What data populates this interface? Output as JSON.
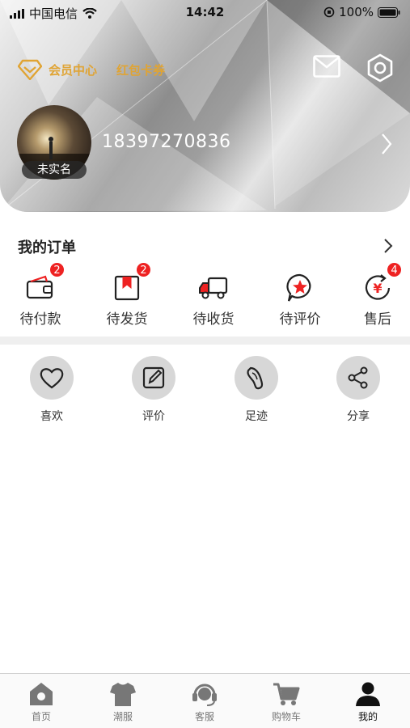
{
  "status_bar": {
    "carrier": "中国电信",
    "time": "14:42",
    "battery": "100%"
  },
  "header": {
    "member_center": "会员中心",
    "red_packet": "红包卡券",
    "avatar_badge": "未实名",
    "phone": "18397270836"
  },
  "orders": {
    "title": "我的订单",
    "items": [
      {
        "label": "待付款",
        "badge": "2"
      },
      {
        "label": "待发货",
        "badge": "2"
      },
      {
        "label": "待收货",
        "badge": ""
      },
      {
        "label": "待评价",
        "badge": ""
      },
      {
        "label": "售后",
        "badge": "4"
      }
    ]
  },
  "tools": [
    {
      "label": "喜欢"
    },
    {
      "label": "评价"
    },
    {
      "label": "足迹"
    },
    {
      "label": "分享"
    }
  ],
  "tabbar": [
    {
      "label": "首页",
      "icon": "home-icon"
    },
    {
      "label": "潮服",
      "icon": "shirt-icon"
    },
    {
      "label": "客服",
      "icon": "headset-icon"
    },
    {
      "label": "购物车",
      "icon": "cart-icon"
    },
    {
      "label": "我的",
      "icon": "user-icon"
    }
  ],
  "colors": {
    "gold": "#e0a434",
    "badge_red": "#e22222",
    "active_tab": "#111111"
  }
}
